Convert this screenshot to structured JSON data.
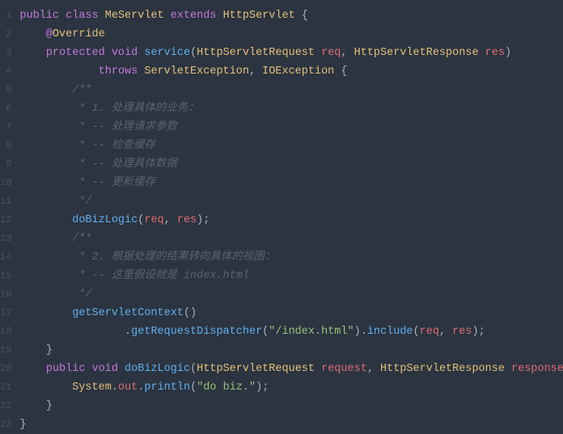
{
  "code": {
    "lines": [
      {
        "n": "1",
        "tokens": [
          {
            "c": "kw",
            "t": "public "
          },
          {
            "c": "kw",
            "t": "class "
          },
          {
            "c": "cls",
            "t": "MeServlet "
          },
          {
            "c": "kw",
            "t": "extends "
          },
          {
            "c": "cls",
            "t": "HttpServlet "
          },
          {
            "c": "punc",
            "t": "{"
          }
        ]
      },
      {
        "n": "2",
        "tokens": [
          {
            "c": "",
            "t": "    "
          },
          {
            "c": "at",
            "t": "@"
          },
          {
            "c": "anno",
            "t": "Override"
          }
        ]
      },
      {
        "n": "3",
        "tokens": [
          {
            "c": "",
            "t": "    "
          },
          {
            "c": "kw",
            "t": "protected "
          },
          {
            "c": "kw",
            "t": "void "
          },
          {
            "c": "fn",
            "t": "service"
          },
          {
            "c": "punc",
            "t": "("
          },
          {
            "c": "param",
            "t": "HttpServletRequest "
          },
          {
            "c": "var",
            "t": "req"
          },
          {
            "c": "punc",
            "t": ", "
          },
          {
            "c": "param",
            "t": "HttpServletResponse "
          },
          {
            "c": "var",
            "t": "res"
          },
          {
            "c": "punc",
            "t": ")"
          }
        ]
      },
      {
        "n": "4",
        "tokens": [
          {
            "c": "",
            "t": "            "
          },
          {
            "c": "kw",
            "t": "throws "
          },
          {
            "c": "cls",
            "t": "ServletException"
          },
          {
            "c": "punc",
            "t": ", "
          },
          {
            "c": "cls",
            "t": "IOException "
          },
          {
            "c": "punc",
            "t": "{"
          }
        ]
      },
      {
        "n": "5",
        "tokens": [
          {
            "c": "",
            "t": "        "
          },
          {
            "c": "cmt",
            "t": "/**"
          }
        ]
      },
      {
        "n": "6",
        "tokens": [
          {
            "c": "",
            "t": "         "
          },
          {
            "c": "cmt",
            "t": "* 1. 处理具体的业务："
          }
        ]
      },
      {
        "n": "7",
        "tokens": [
          {
            "c": "",
            "t": "         "
          },
          {
            "c": "cmt",
            "t": "* -- 处理请求参数"
          }
        ]
      },
      {
        "n": "8",
        "tokens": [
          {
            "c": "",
            "t": "         "
          },
          {
            "c": "cmt",
            "t": "* -- 检查缓存"
          }
        ]
      },
      {
        "n": "9",
        "tokens": [
          {
            "c": "",
            "t": "         "
          },
          {
            "c": "cmt",
            "t": "* -- 处理具体数据"
          }
        ]
      },
      {
        "n": "10",
        "tokens": [
          {
            "c": "",
            "t": "         "
          },
          {
            "c": "cmt",
            "t": "* -- 更新缓存"
          }
        ]
      },
      {
        "n": "11",
        "tokens": [
          {
            "c": "",
            "t": "         "
          },
          {
            "c": "cmt",
            "t": "*/"
          }
        ]
      },
      {
        "n": "12",
        "tokens": [
          {
            "c": "",
            "t": "        "
          },
          {
            "c": "fn",
            "t": "doBizLogic"
          },
          {
            "c": "punc",
            "t": "("
          },
          {
            "c": "var",
            "t": "req"
          },
          {
            "c": "punc",
            "t": ", "
          },
          {
            "c": "var",
            "t": "res"
          },
          {
            "c": "punc",
            "t": ");"
          }
        ]
      },
      {
        "n": "13",
        "tokens": [
          {
            "c": "",
            "t": "        "
          },
          {
            "c": "cmt",
            "t": "/**"
          }
        ]
      },
      {
        "n": "14",
        "tokens": [
          {
            "c": "",
            "t": "         "
          },
          {
            "c": "cmt",
            "t": "* 2. 根据处理的结果转向具体的视图："
          }
        ]
      },
      {
        "n": "15",
        "tokens": [
          {
            "c": "",
            "t": "         "
          },
          {
            "c": "cmt",
            "t": "* -- 这里假设就是 index.html"
          }
        ]
      },
      {
        "n": "16",
        "tokens": [
          {
            "c": "",
            "t": "         "
          },
          {
            "c": "cmt",
            "t": "*/"
          }
        ]
      },
      {
        "n": "17",
        "tokens": [
          {
            "c": "",
            "t": "        "
          },
          {
            "c": "fn",
            "t": "getServletContext"
          },
          {
            "c": "punc",
            "t": "()"
          }
        ]
      },
      {
        "n": "18",
        "tokens": [
          {
            "c": "",
            "t": "                "
          },
          {
            "c": "punc",
            "t": "."
          },
          {
            "c": "fn",
            "t": "getRequestDispatcher"
          },
          {
            "c": "punc",
            "t": "("
          },
          {
            "c": "str",
            "t": "\"/index.html\""
          },
          {
            "c": "punc",
            "t": ")."
          },
          {
            "c": "fn",
            "t": "include"
          },
          {
            "c": "punc",
            "t": "("
          },
          {
            "c": "var",
            "t": "req"
          },
          {
            "c": "punc",
            "t": ", "
          },
          {
            "c": "var",
            "t": "res"
          },
          {
            "c": "punc",
            "t": ");"
          }
        ]
      },
      {
        "n": "19",
        "tokens": [
          {
            "c": "",
            "t": "    "
          },
          {
            "c": "punc",
            "t": "}"
          }
        ]
      },
      {
        "n": "20",
        "tokens": [
          {
            "c": "",
            "t": "    "
          },
          {
            "c": "kw",
            "t": "public "
          },
          {
            "c": "kw",
            "t": "void "
          },
          {
            "c": "fn",
            "t": "doBizLogic"
          },
          {
            "c": "punc",
            "t": "("
          },
          {
            "c": "param",
            "t": "HttpServletRequest "
          },
          {
            "c": "var",
            "t": "request"
          },
          {
            "c": "punc",
            "t": ", "
          },
          {
            "c": "param",
            "t": "HttpServletResponse "
          },
          {
            "c": "var",
            "t": "response"
          },
          {
            "c": "punc",
            "t": ") {"
          }
        ]
      },
      {
        "n": "21",
        "tokens": [
          {
            "c": "",
            "t": "        "
          },
          {
            "c": "cls",
            "t": "System"
          },
          {
            "c": "punc",
            "t": "."
          },
          {
            "c": "var",
            "t": "out"
          },
          {
            "c": "punc",
            "t": "."
          },
          {
            "c": "fn",
            "t": "println"
          },
          {
            "c": "punc",
            "t": "("
          },
          {
            "c": "str",
            "t": "\"do biz.\""
          },
          {
            "c": "punc",
            "t": ");"
          }
        ]
      },
      {
        "n": "22",
        "tokens": [
          {
            "c": "",
            "t": "    "
          },
          {
            "c": "punc",
            "t": "}"
          }
        ]
      },
      {
        "n": "23",
        "tokens": [
          {
            "c": "punc",
            "t": "}"
          }
        ]
      }
    ]
  }
}
